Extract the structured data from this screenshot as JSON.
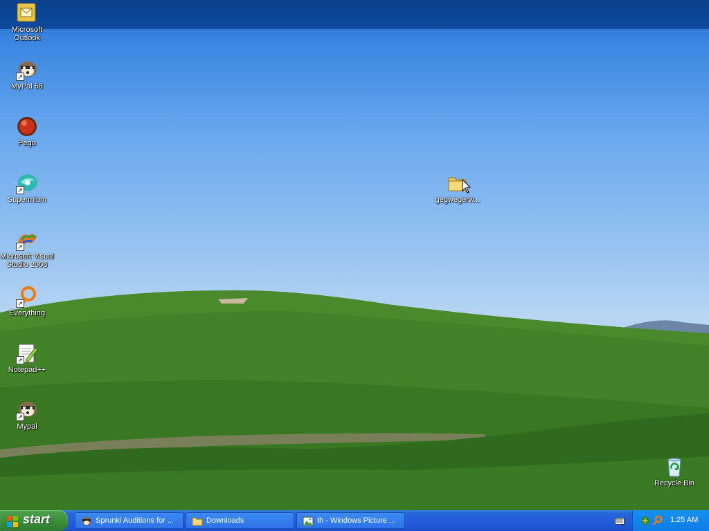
{
  "desktop": {
    "icons": [
      {
        "label": "Microsoft Outlook"
      },
      {
        "label": "MyPal 68"
      },
      {
        "label": "Pego"
      },
      {
        "label": "Supermium"
      },
      {
        "label": "Microsoft Visual Studio 2008"
      },
      {
        "label": "Everything"
      },
      {
        "label": "Notepad++"
      },
      {
        "label": "Mypal"
      },
      {
        "label": "gegwegerw..."
      },
      {
        "label": "Recycle Bin"
      }
    ]
  },
  "taskbar": {
    "start_label": "start",
    "tasks": [
      {
        "label": "Sprunki Auditions for ...",
        "icon": "mypal-icon"
      },
      {
        "label": "Downloads",
        "icon": "folder-icon"
      },
      {
        "label": "th - Windows Picture ...",
        "icon": "picture-viewer-icon"
      }
    ],
    "clock": "1:25 AM"
  },
  "colors": {
    "taskbar_blue": "#245edb",
    "start_green": "#3c8f3c",
    "tray_blue": "#0f7be6"
  }
}
